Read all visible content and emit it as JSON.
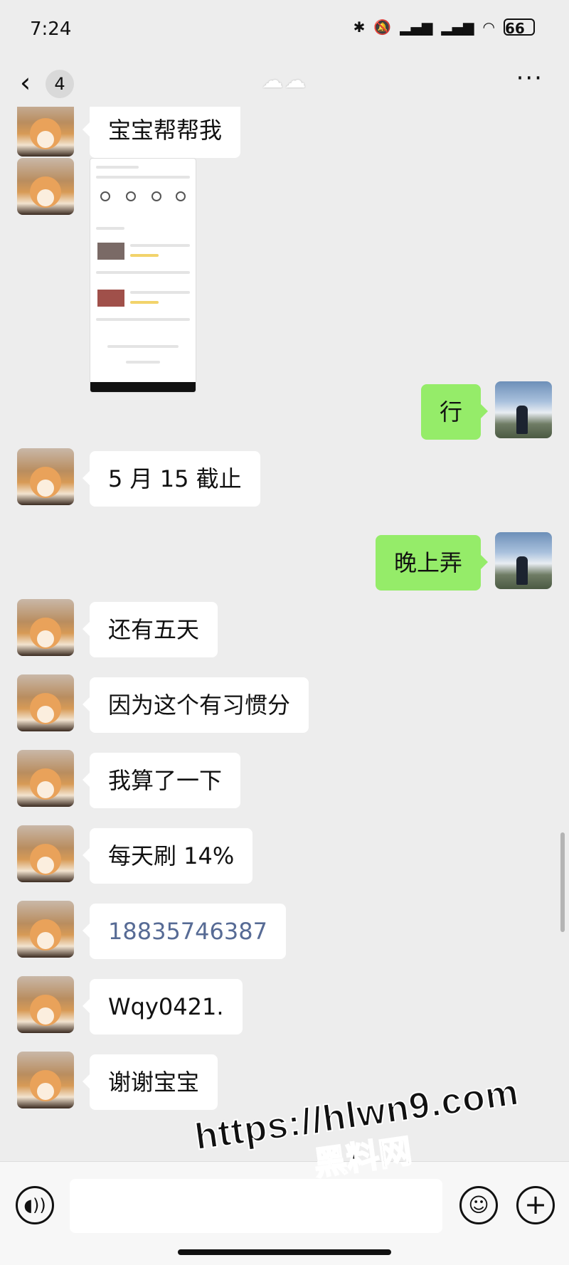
{
  "status_bar": {
    "time": "7:24",
    "icons": [
      "bluetooth-icon",
      "mute-icon",
      "hd-signal-icon",
      "hd-signal-icon",
      "wifi-icon"
    ],
    "battery": "66"
  },
  "nav": {
    "back_icon": "‹",
    "unread_count": "4",
    "title": "☁☁",
    "more_icon": "···"
  },
  "messages": [
    {
      "side": "left",
      "type": "text",
      "text": "宝宝帮帮我"
    },
    {
      "side": "left",
      "type": "image"
    },
    {
      "side": "right",
      "type": "text",
      "text": "行"
    },
    {
      "side": "left",
      "type": "text",
      "text": "5 月 15 截止"
    },
    {
      "side": "right",
      "type": "text",
      "text": "晚上弄"
    },
    {
      "side": "left",
      "type": "text",
      "text": "还有五天"
    },
    {
      "side": "left",
      "type": "text",
      "text": "因为这个有习惯分"
    },
    {
      "side": "left",
      "type": "text",
      "text": "我算了一下"
    },
    {
      "side": "left",
      "type": "text",
      "text": "每天刷 14%"
    },
    {
      "side": "left",
      "type": "link",
      "text": "18835746387"
    },
    {
      "side": "left",
      "type": "text",
      "text": "Wqy0421."
    },
    {
      "side": "left",
      "type": "text",
      "text": "谢谢宝宝"
    }
  ],
  "input_bar": {
    "voice_icon": "◖))",
    "emoji_icon": "☺",
    "plus_icon": "+"
  },
  "watermark": {
    "url": "https://hlwn9.com",
    "name": "黑料网"
  }
}
